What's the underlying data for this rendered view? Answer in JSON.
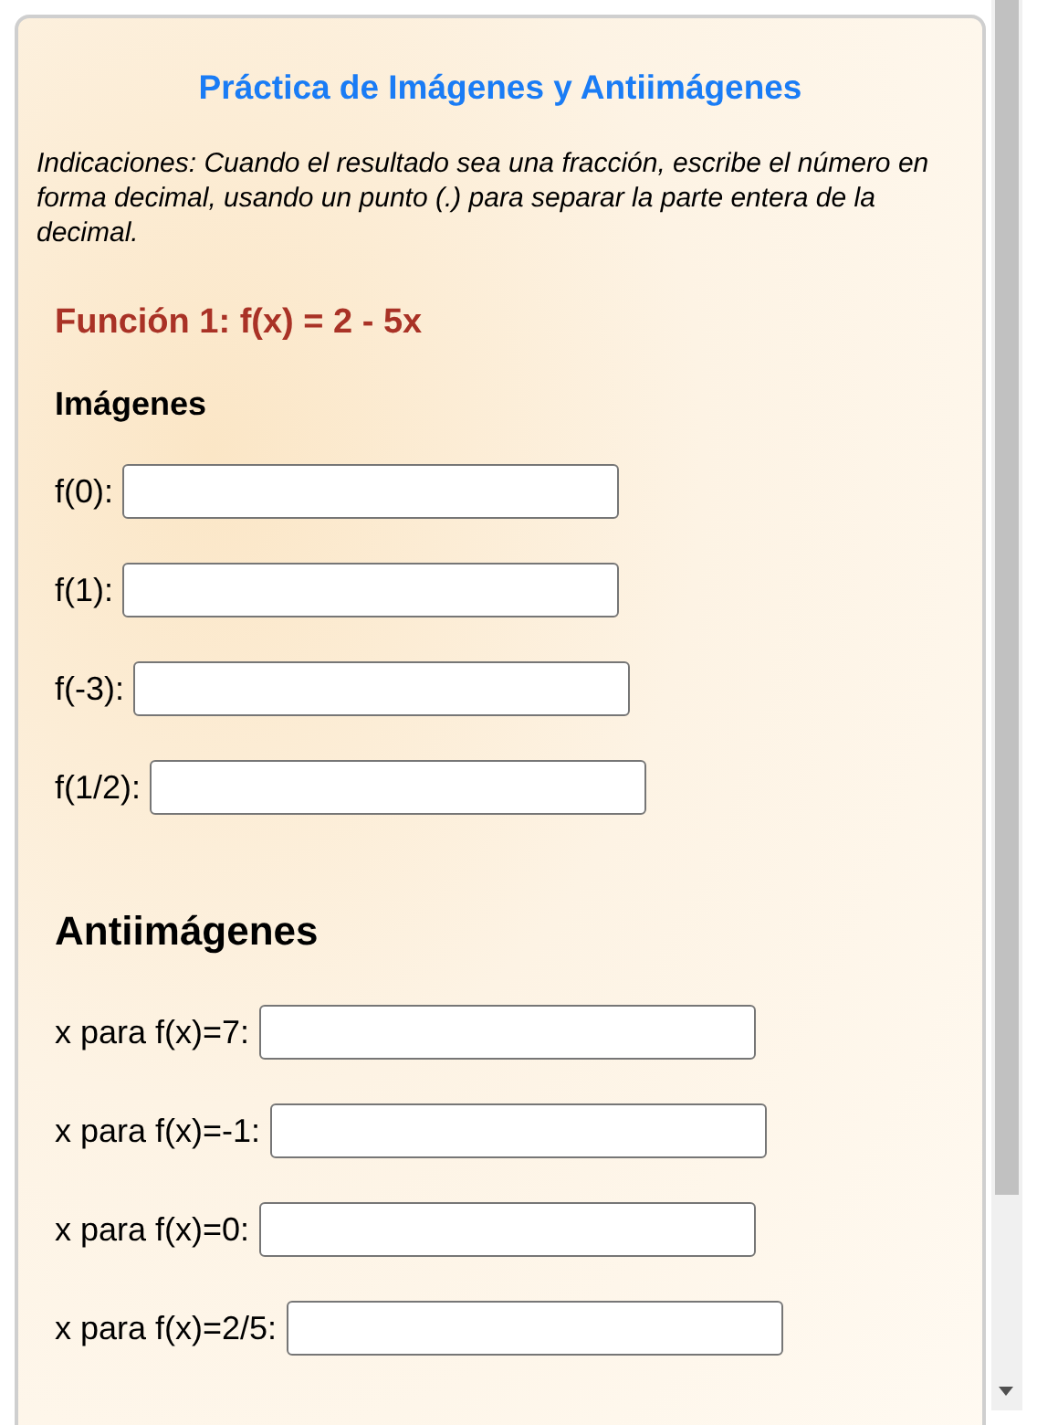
{
  "title": "Práctica de Imágenes y Antiimágenes",
  "instructions": "Indicaciones: Cuando el resultado sea una fracción, escribe el número en forma decimal, usando un punto (.) para separar la parte entera de la decimal.",
  "function_heading": "Función 1: f(x) = 2 - 5x",
  "images": {
    "heading": "Imágenes",
    "fields": [
      {
        "label": "f(0):"
      },
      {
        "label": "f(1):"
      },
      {
        "label": "f(-3):"
      },
      {
        "label": "f(1/2):"
      }
    ]
  },
  "preimages": {
    "heading": "Antiimágenes",
    "fields": [
      {
        "label": "x para f(x)=7:"
      },
      {
        "label": "x para f(x)=-1:"
      },
      {
        "label": "x para f(x)=0:"
      },
      {
        "label": "x para f(x)=2/5:"
      }
    ]
  }
}
